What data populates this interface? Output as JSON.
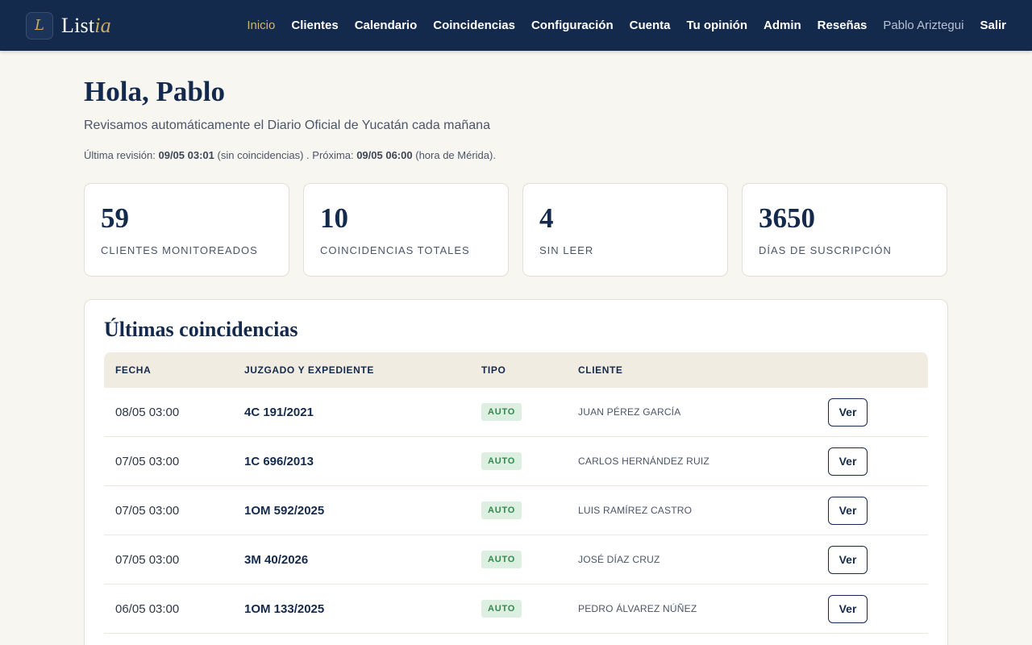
{
  "brand": {
    "mark": "L",
    "name_main": "List",
    "name_accent": "ia"
  },
  "nav": {
    "items": [
      "Inicio",
      "Clientes",
      "Calendario",
      "Coincidencias",
      "Configuración",
      "Cuenta",
      "Tu opinión",
      "Admin",
      "Reseñas"
    ],
    "active": "Inicio",
    "user": "Pablo Ariztegui",
    "logout": "Salir"
  },
  "header": {
    "greeting": "Hola, Pablo",
    "subtitle": "Revisamos automáticamente el Diario Oficial de Yucatán cada mañana",
    "review_prefix": "Última revisión:",
    "review_last": "09/05 03:01",
    "review_status": "(sin coincidencias) . Próxima:",
    "review_next": "09/05 06:00",
    "review_suffix": "(hora de Mérida)."
  },
  "stats": [
    {
      "value": "59",
      "label": "CLIENTES MONITOREADOS"
    },
    {
      "value": "10",
      "label": "COINCIDENCIAS TOTALES"
    },
    {
      "value": "4",
      "label": "SIN LEER"
    },
    {
      "value": "3650",
      "label": "DÍAS DE SUSCRIPCIÓN"
    }
  ],
  "matches": {
    "title": "Últimas coincidencias",
    "columns": {
      "date": "FECHA",
      "case": "JUZGADO Y EXPEDIENTE",
      "type": "TIPO",
      "client": "CLIENTE"
    },
    "view_label": "Ver",
    "rows": [
      {
        "date": "08/05 03:00",
        "case": "4C 191/2021",
        "type": "AUTO",
        "client": "JUAN PÉREZ GARCÍA"
      },
      {
        "date": "07/05 03:00",
        "case": "1C 696/2013",
        "type": "AUTO",
        "client": "CARLOS HERNÁNDEZ RUIZ"
      },
      {
        "date": "07/05 03:00",
        "case": "1OM 592/2025",
        "type": "AUTO",
        "client": "LUIS RAMÍREZ CASTRO"
      },
      {
        "date": "07/05 03:00",
        "case": "3M 40/2026",
        "type": "AUTO",
        "client": "JOSÉ DÍAZ CRUZ"
      },
      {
        "date": "06/05 03:00",
        "case": "1OM 133/2025",
        "type": "AUTO",
        "client": "PEDRO ÁLVAREZ NÚÑEZ"
      }
    ]
  },
  "colors": {
    "navbar": "#142a4d",
    "accent_gold": "#c9a868",
    "badge_bg": "#dcefe1",
    "badge_text": "#2f8a4b",
    "page_bg": "#f8f6f1"
  }
}
